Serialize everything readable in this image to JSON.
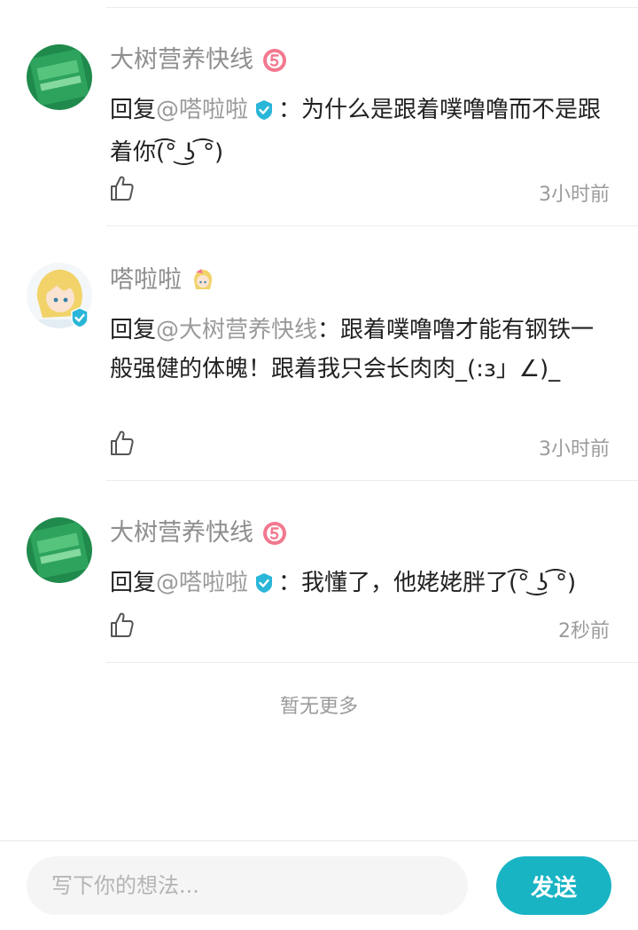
{
  "comments": [
    {
      "username": "大树营养快线",
      "level_icon": "level-5-badge",
      "reply_prefix": "回复",
      "mention": "@嗒啦啦",
      "colon": "：",
      "text": "为什么是跟着噗噜噜而不是跟着你(͡° ͜ʖ ͡°)",
      "time": "3小时前"
    },
    {
      "username": "嗒啦啦",
      "level_icon": "anime-sticker-badge",
      "reply_prefix": "回复",
      "mention": "@大树营养快线",
      "colon": "：",
      "text": "跟着噗噜噜才能有钢铁一般强健的体魄！跟着我只会长肉肉_(:з」∠)_",
      "time": "3小时前"
    },
    {
      "username": "大树营养快线",
      "level_icon": "level-5-badge",
      "reply_prefix": "回复",
      "mention": "@嗒啦啦",
      "colon": "：",
      "text": "我懂了，他姥姥胖了(͡° ͜ʖ ͡°)",
      "time": "2秒前"
    }
  ],
  "footer": {
    "no_more": "暂无更多"
  },
  "composer": {
    "placeholder": "写下你的想法...",
    "send_label": "发送"
  },
  "colors": {
    "accent": "#19b4c4",
    "verified": "#29b6d8",
    "level_badge": "#f2788f"
  }
}
